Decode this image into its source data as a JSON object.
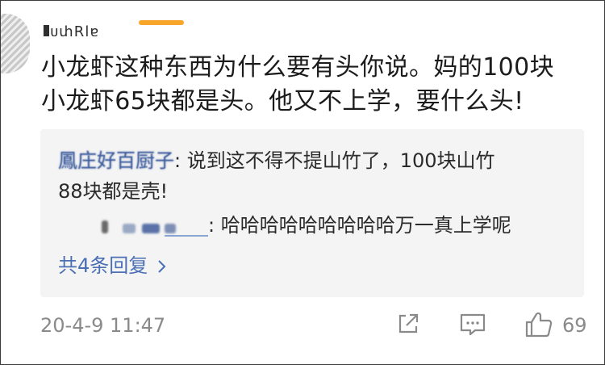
{
  "comment": {
    "username": "▐ᴜփⱤḷɐ",
    "text_line1": "小龙虾这种东西为什么要有头你说。妈的100块",
    "text_line2": "小龙虾65块都是头。他又不上学，要什么头!"
  },
  "replies": [
    {
      "author": "鳳庄好百厨子",
      "separator": ": ",
      "text_line1": "说到这不得不提山竹了，100块山竹",
      "text_line2": "88块都是壳!"
    },
    {
      "author": "",
      "separator": ": ",
      "text": "哈哈哈哈哈哈哈哈哈万一真上学呢"
    }
  ],
  "more_replies_label": "共4条回复",
  "more_replies_icon": "chevron-right-icon",
  "timestamp": "20-4-9 11:47",
  "actions": {
    "share_icon": "share-icon",
    "comment_icon": "comment-icon",
    "like_icon": "thumbs-up-icon",
    "like_count": "69"
  },
  "colors": {
    "link_blue": "#4a6fb5",
    "tab_accent": "#f7a52b",
    "reply_bg": "#f4f4f4",
    "meta_gray": "#8a8a8a"
  }
}
